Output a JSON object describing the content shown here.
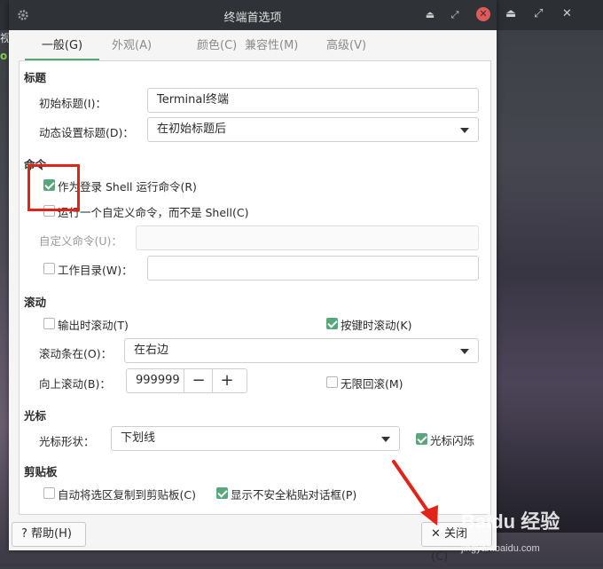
{
  "window": {
    "title": "终端首选项",
    "tabs": [
      "一般(G)",
      "外观(A)",
      "颜色(C)",
      "兼容性(M)",
      "高级(V)"
    ],
    "active_tab_index": 0
  },
  "background": {
    "left_text_1": "视",
    "left_text_2": "o",
    "watermark": "Baidu 经验",
    "watermark_sub": "jingyan.baidu.com"
  },
  "title_section": {
    "heading": "标题",
    "initial_title_label": "初始标题(I)：",
    "initial_title_value": "Terminal终端",
    "dynamic_title_label": "动态设置标题(D)：",
    "dynamic_title_value": "在初始标题后"
  },
  "command_section": {
    "heading": "命令",
    "login_shell_label": "作为登录 Shell 运行命令(R)",
    "login_shell_checked": true,
    "custom_command_label": "运行一个自定义命令，而不是 Shell(C)",
    "custom_command_checked": false,
    "custom_command_field_label": "自定义命令(U)：",
    "custom_command_value": "",
    "working_dir_label": "工作目录(W)：",
    "working_dir_checked": false,
    "working_dir_value": ""
  },
  "scroll_section": {
    "heading": "滚动",
    "scroll_on_output_label": "输出时滚动(T)",
    "scroll_on_output_checked": false,
    "scroll_on_keystroke_label": "按键时滚动(K)",
    "scroll_on_keystroke_checked": true,
    "scrollbar_label": "滚动条在(O)：",
    "scrollbar_value": "在右边",
    "scrollback_label": "向上滚动(B)：",
    "scrollback_value": "999999",
    "minus_symbol": "−",
    "plus_symbol": "+",
    "unlimited_label": "无限回滚(M)",
    "unlimited_checked": false
  },
  "cursor_section": {
    "heading": "光标",
    "shape_label": "光标形状：",
    "shape_value": "下划线",
    "blink_label": "光标闪烁",
    "blink_checked": true
  },
  "clipboard_section": {
    "heading": "剪贴板",
    "auto_copy_label": "自动将选区复制到剪贴板(C)",
    "auto_copy_checked": false,
    "unsafe_paste_label": "显示不安全粘贴对话框(P)",
    "unsafe_paste_checked": true
  },
  "footer": {
    "help_label": "帮助(H)",
    "help_icon": "?",
    "close_label": "关闭(C)",
    "close_icon": "✕"
  },
  "colors": {
    "accent": "#5aa67b",
    "annotation_red": "#e2231a"
  }
}
